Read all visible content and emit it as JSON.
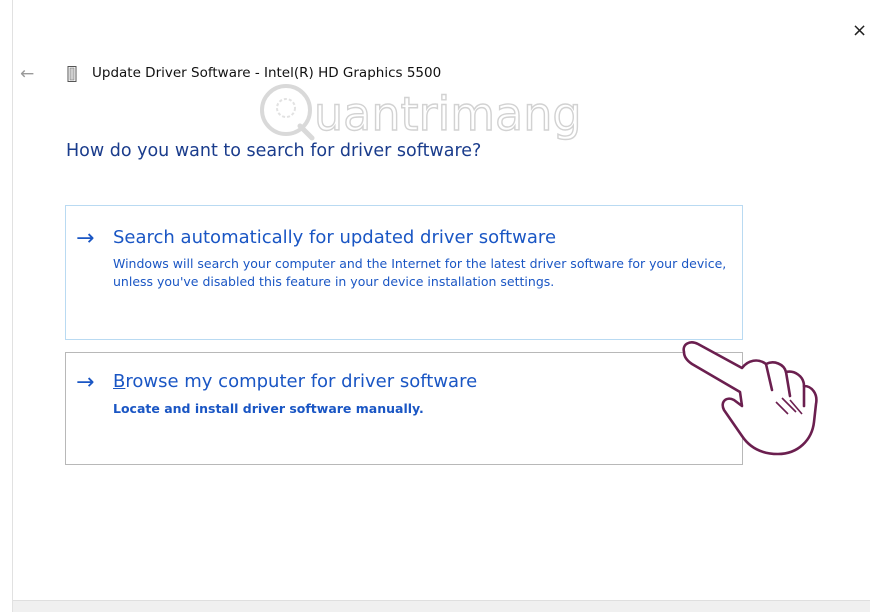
{
  "window": {
    "title": "Update Driver Software - Intel(R) HD Graphics 5500",
    "close_glyph": "×",
    "back_glyph": "←",
    "icons": [
      "close-icon",
      "back-arrow-icon",
      "device-icon"
    ]
  },
  "watermark": {
    "text": "uantrimang",
    "logo_letter": "Q"
  },
  "main": {
    "question": "How do you want to search for driver software?",
    "options": [
      {
        "arrow": "→",
        "title": "Search automatically for updated driver software",
        "description": "Windows will search your computer and the Internet for the latest driver software for your device, unless you've disabled this feature in your device installation settings."
      },
      {
        "arrow": "→",
        "title_access_key": "B",
        "title_rest": "rowse my computer for driver software",
        "description": "Locate and install driver software manually."
      }
    ]
  },
  "colors": {
    "accent_blue": "#1a56c4",
    "heading_blue": "#1a3c8c",
    "option_border_light": "#b9daf2",
    "option_border_gray": "#b8b8b8",
    "hand_annotation": "#6b1f4f"
  }
}
